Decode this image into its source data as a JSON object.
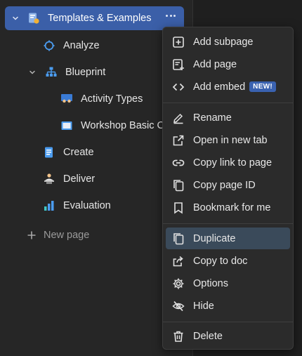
{
  "sidebar": {
    "root": {
      "label": "Templates & Examples",
      "icon": "doc-template-icon"
    },
    "items": [
      {
        "label": "Analyze",
        "icon": "target-crosshair-icon"
      },
      {
        "label": "Blueprint",
        "icon": "org-chart-icon"
      },
      {
        "label": "Activity Types",
        "icon": "people-group-icon"
      },
      {
        "label": "Workshop Basic Concepts",
        "icon": "window-icon"
      },
      {
        "label": "Create",
        "icon": "document-icon"
      },
      {
        "label": "Deliver",
        "icon": "delivery-person-icon"
      },
      {
        "label": "Evaluation",
        "icon": "bar-chart-icon"
      }
    ],
    "new_page": "New page"
  },
  "menu": {
    "items": [
      {
        "label": "Add subpage",
        "icon": "plus-square-icon"
      },
      {
        "label": "Add page",
        "icon": "add-page-icon"
      },
      {
        "label": "Add embed",
        "icon": "code-brackets-icon",
        "badge": "NEW!"
      },
      {
        "label": "Rename",
        "icon": "pencil-icon"
      },
      {
        "label": "Open in new tab",
        "icon": "external-link-icon"
      },
      {
        "label": "Copy link to page",
        "icon": "link-icon"
      },
      {
        "label": "Copy page ID",
        "icon": "copy-icon"
      },
      {
        "label": "Bookmark for me",
        "icon": "bookmark-icon"
      },
      {
        "label": "Duplicate",
        "icon": "duplicate-icon"
      },
      {
        "label": "Copy to doc",
        "icon": "share-arrow-icon"
      },
      {
        "label": "Options",
        "icon": "gear-icon"
      },
      {
        "label": "Hide",
        "icon": "eye-off-icon"
      },
      {
        "label": "Delete",
        "icon": "trash-icon"
      }
    ]
  },
  "colors": {
    "selected_bg": "#3b5fa8",
    "hover_bg": "#3a4a5a",
    "badge_bg": "#3a62b0"
  }
}
